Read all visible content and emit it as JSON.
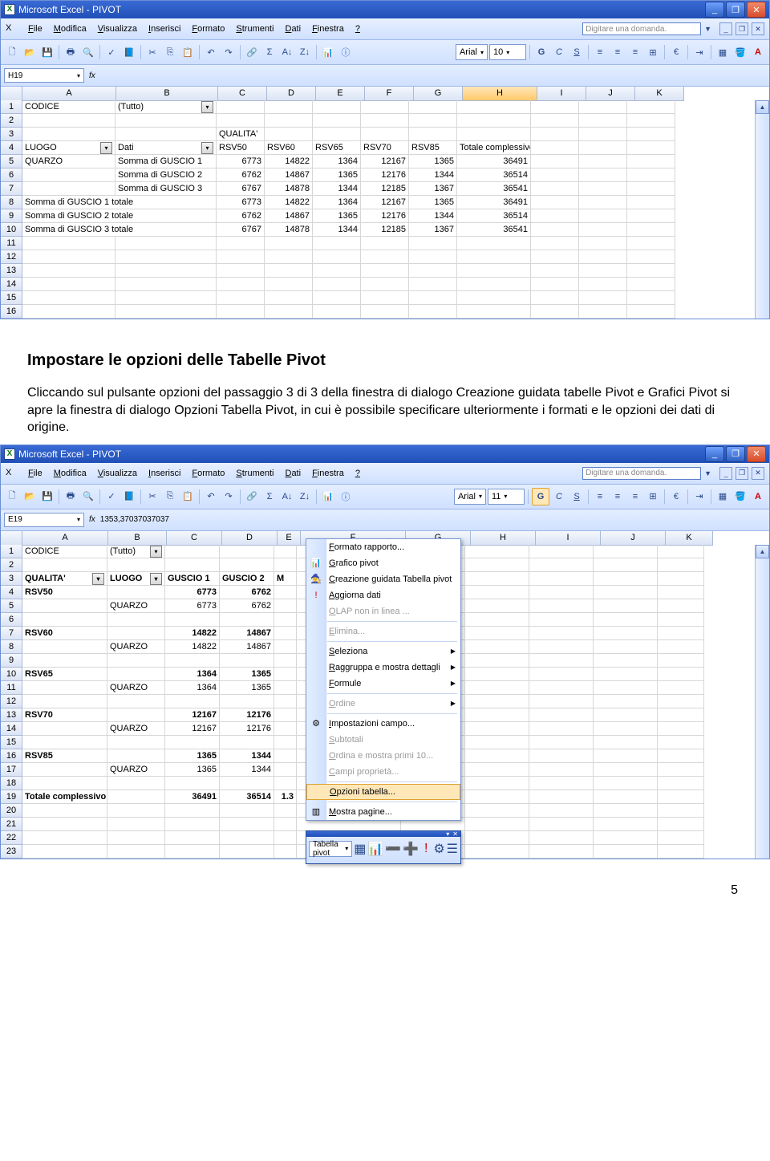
{
  "title_app": "Microsoft Excel - PIVOT",
  "ask_placeholder": "Digitare una domanda.",
  "menu": [
    "File",
    "Modifica",
    "Visualizza",
    "Inserisci",
    "Formato",
    "Strumenti",
    "Dati",
    "Finestra",
    "?"
  ],
  "font_name": "Arial",
  "font_size1": "10",
  "font_size2": "11",
  "namebox1": "H19",
  "namebox2": "E19",
  "fx_val2": "1353,37037037037",
  "cols1": {
    "A": 116,
    "B": 126,
    "C": 60,
    "D": 60,
    "E": 60,
    "F": 60,
    "G": 60,
    "H": 92,
    "I": 60,
    "J": 60,
    "K": 60
  },
  "grid1": [
    {
      "r": "1",
      "A": "CODICE",
      "B": "(Tutto)",
      "Bdrop": true
    },
    {
      "r": "2"
    },
    {
      "r": "3",
      "C": "QUALITA'",
      "Cdrop": true
    },
    {
      "r": "4",
      "A": "LUOGO",
      "Adrop": true,
      "B": "Dati",
      "Bdrop": true,
      "C": "RSV50",
      "D": "RSV60",
      "E": "RSV65",
      "F": "RSV70",
      "G": "RSV85",
      "H": "Totale complessivo"
    },
    {
      "r": "5",
      "A": "QUARZO",
      "B": "Somma di GUSCIO 1",
      "C": "6773",
      "D": "14822",
      "E": "1364",
      "F": "12167",
      "G": "1365",
      "H": "36491",
      "num": true
    },
    {
      "r": "6",
      "B": "Somma di GUSCIO 2",
      "C": "6762",
      "D": "14867",
      "E": "1365",
      "F": "12176",
      "G": "1344",
      "H": "36514",
      "num": true
    },
    {
      "r": "7",
      "B": "Somma di GUSCIO 3",
      "C": "6767",
      "D": "14878",
      "E": "1344",
      "F": "12185",
      "G": "1367",
      "H": "36541",
      "num": true
    },
    {
      "r": "8",
      "A": "Somma di GUSCIO 1 totale",
      "span": true,
      "C": "6773",
      "D": "14822",
      "E": "1364",
      "F": "12167",
      "G": "1365",
      "H": "36491",
      "num": true
    },
    {
      "r": "9",
      "A": "Somma di GUSCIO 2 totale",
      "span": true,
      "C": "6762",
      "D": "14867",
      "E": "1365",
      "F": "12176",
      "G": "1344",
      "H": "36514",
      "num": true
    },
    {
      "r": "10",
      "A": "Somma di GUSCIO 3 totale",
      "span": true,
      "C": "6767",
      "D": "14878",
      "E": "1344",
      "F": "12185",
      "G": "1367",
      "H": "36541",
      "num": true
    },
    {
      "r": "11"
    },
    {
      "r": "12"
    },
    {
      "r": "13"
    },
    {
      "r": "14"
    },
    {
      "r": "15"
    },
    {
      "r": "16"
    }
  ],
  "cols2": {
    "A": 106,
    "B": 72,
    "C": 68,
    "D": 68,
    "E": 28,
    "F": 130,
    "G": 80,
    "H": 80,
    "I": 80,
    "J": 80,
    "K": 58
  },
  "grid2": [
    {
      "r": "1",
      "A": "CODICE",
      "B": "(Tutto)",
      "Bdrop": true
    },
    {
      "r": "2"
    },
    {
      "r": "3",
      "A": "QUALITA'",
      "Adrop": true,
      "B": "LUOGO",
      "Bdrop": true,
      "C": "GUSCIO 1",
      "D": "GUSCIO 2",
      "E": "M",
      "bold": true
    },
    {
      "r": "4",
      "A": "RSV50",
      "C": "6773",
      "D": "6762",
      "bold": true,
      "num": true
    },
    {
      "r": "5",
      "B": "QUARZO",
      "C": "6773",
      "D": "6762",
      "num": true
    },
    {
      "r": "6"
    },
    {
      "r": "7",
      "A": "RSV60",
      "C": "14822",
      "D": "14867",
      "bold": true,
      "num": true
    },
    {
      "r": "8",
      "B": "QUARZO",
      "C": "14822",
      "D": "14867",
      "num": true
    },
    {
      "r": "9"
    },
    {
      "r": "10",
      "A": "RSV65",
      "C": "1364",
      "D": "1365",
      "bold": true,
      "num": true
    },
    {
      "r": "11",
      "B": "QUARZO",
      "C": "1364",
      "D": "1365",
      "num": true
    },
    {
      "r": "12"
    },
    {
      "r": "13",
      "A": "RSV70",
      "C": "12167",
      "D": "12176",
      "bold": true,
      "num": true
    },
    {
      "r": "14",
      "B": "QUARZO",
      "C": "12167",
      "D": "12176",
      "num": true
    },
    {
      "r": "15"
    },
    {
      "r": "16",
      "A": "RSV85",
      "C": "1365",
      "D": "1344",
      "bold": true,
      "num": true
    },
    {
      "r": "17",
      "B": "QUARZO",
      "C": "1365",
      "D": "1344",
      "num": true
    },
    {
      "r": "18"
    },
    {
      "r": "19",
      "A": "Totale complessivo",
      "C": "36491",
      "D": "36514",
      "E": "1.3",
      "bold": true,
      "num": true
    },
    {
      "r": "20"
    },
    {
      "r": "21"
    },
    {
      "r": "22"
    },
    {
      "r": "23"
    }
  ],
  "heading": "Impostare le opzioni delle Tabelle Pivot",
  "paragraph": "Cliccando sul pulsante opzioni del passaggio 3 di 3 della finestra di dialogo Creazione guidata tabelle Pivot e Grafici Pivot si apre la finestra di dialogo Opzioni Tabella Pivot, in cui è possibile specificare ulteriormente i formati e le opzioni dei dati di origine.",
  "ctx": {
    "items": [
      {
        "t": "Formato rapporto..."
      },
      {
        "t": "Grafico pivot",
        "icon": "chart"
      },
      {
        "t": "Creazione guidata Tabella pivot",
        "icon": "wiz"
      },
      {
        "t": "Aggiorna dati",
        "icon": "ref"
      },
      {
        "t": "OLAP non in linea ...",
        "dis": true
      },
      {
        "sep": true
      },
      {
        "t": "Elimina...",
        "dis": true
      },
      {
        "sep": true
      },
      {
        "t": "Seleziona",
        "sub": true
      },
      {
        "t": "Raggruppa e mostra dettagli",
        "sub": true
      },
      {
        "t": "Formule",
        "sub": true
      },
      {
        "sep": true
      },
      {
        "t": "Ordine",
        "sub": true,
        "dis": true
      },
      {
        "sep": true
      },
      {
        "t": "Impostazioni campo...",
        "icon": "set"
      },
      {
        "t": "Subtotali",
        "dis": true
      },
      {
        "t": "Ordina e mostra primi 10...",
        "dis": true
      },
      {
        "t": "Campi proprietà...",
        "dis": true
      },
      {
        "sep": true
      },
      {
        "t": "Opzioni tabella...",
        "sel": true
      },
      {
        "sep": true
      },
      {
        "t": "Mostra pagine...",
        "icon": "pg"
      }
    ]
  },
  "pivot_tb_label": "Tabella pivot",
  "page_number": "5"
}
